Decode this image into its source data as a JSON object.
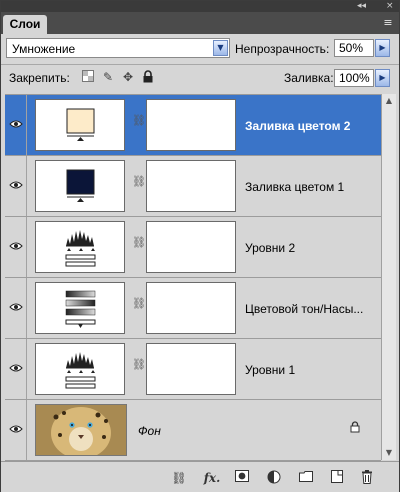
{
  "panel": {
    "tab_label": "Слои",
    "title_controls": [
      "◂◂",
      "×"
    ],
    "menu_glyph": "≡"
  },
  "blend": {
    "mode": "Умножение",
    "opacity_label": "Непрозрачность:",
    "opacity_value": "50%"
  },
  "lock": {
    "label": "Закрепить:",
    "icons": [
      "lock-transparent-pixels-icon",
      "lock-image-pixels-icon",
      "lock-position-icon",
      "lock-all-icon"
    ],
    "fill_label": "Заливка:",
    "fill_value": "100%"
  },
  "layers": [
    {
      "name": "Заливка цветом 2",
      "type": "color-fill",
      "swatch": "#fdebc9",
      "selected": true
    },
    {
      "name": "Заливка цветом 1",
      "type": "color-fill",
      "swatch": "#0b1538",
      "selected": false
    },
    {
      "name": "Уровни 2",
      "type": "levels",
      "selected": false
    },
    {
      "name": "Цветовой тон/Насы...",
      "type": "hue-saturation",
      "selected": false
    },
    {
      "name": "Уровни 1",
      "type": "levels",
      "selected": false
    },
    {
      "name": "Фон",
      "type": "background",
      "selected": false
    }
  ],
  "toolbar": {
    "fx_label": "fx.",
    "icons": [
      "link-layers-icon",
      "layer-style-icon",
      "add-mask-icon",
      "adjustment-layer-icon",
      "new-group-icon",
      "new-layer-icon",
      "delete-layer-icon"
    ]
  },
  "colors": {
    "selected_row": "#3a74c8",
    "panel_bg": "#d6d6d6"
  }
}
